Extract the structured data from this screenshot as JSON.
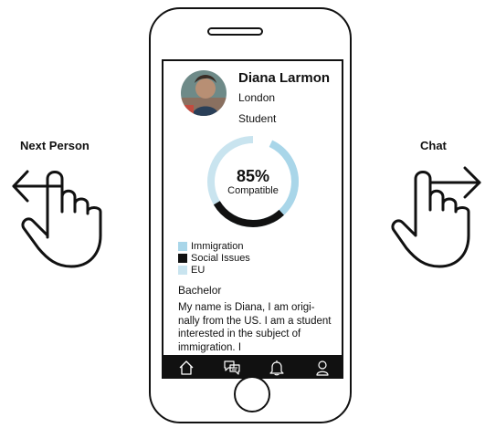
{
  "profile": {
    "name": "Diana Larmon",
    "city": "London",
    "occupation": "Student",
    "compatibility": {
      "value": 85,
      "percent_text": "85%",
      "label": "Compatible"
    },
    "legend": [
      {
        "label": "Immigration",
        "color": "#a9d6e9"
      },
      {
        "label": "Social Issues",
        "color": "#111111"
      },
      {
        "label": "EU",
        "color": "#c9e4ef"
      }
    ],
    "degree": "Bachelor",
    "bio": "My name is Diana, I am origi-nally from the US. I am a student interested in the subject of immigration. I"
  },
  "gestures": {
    "left_label": "Next Person",
    "right_label": "Chat"
  },
  "nav": [
    {
      "icon": "home-icon"
    },
    {
      "icon": "chat-icon"
    },
    {
      "icon": "bell-icon"
    },
    {
      "icon": "profile-icon"
    }
  ],
  "colors": {
    "ring_light": "#a9d6e9",
    "ring_pale": "#c9e4ef",
    "ring_dark": "#111111",
    "nav_background": "#111111"
  }
}
